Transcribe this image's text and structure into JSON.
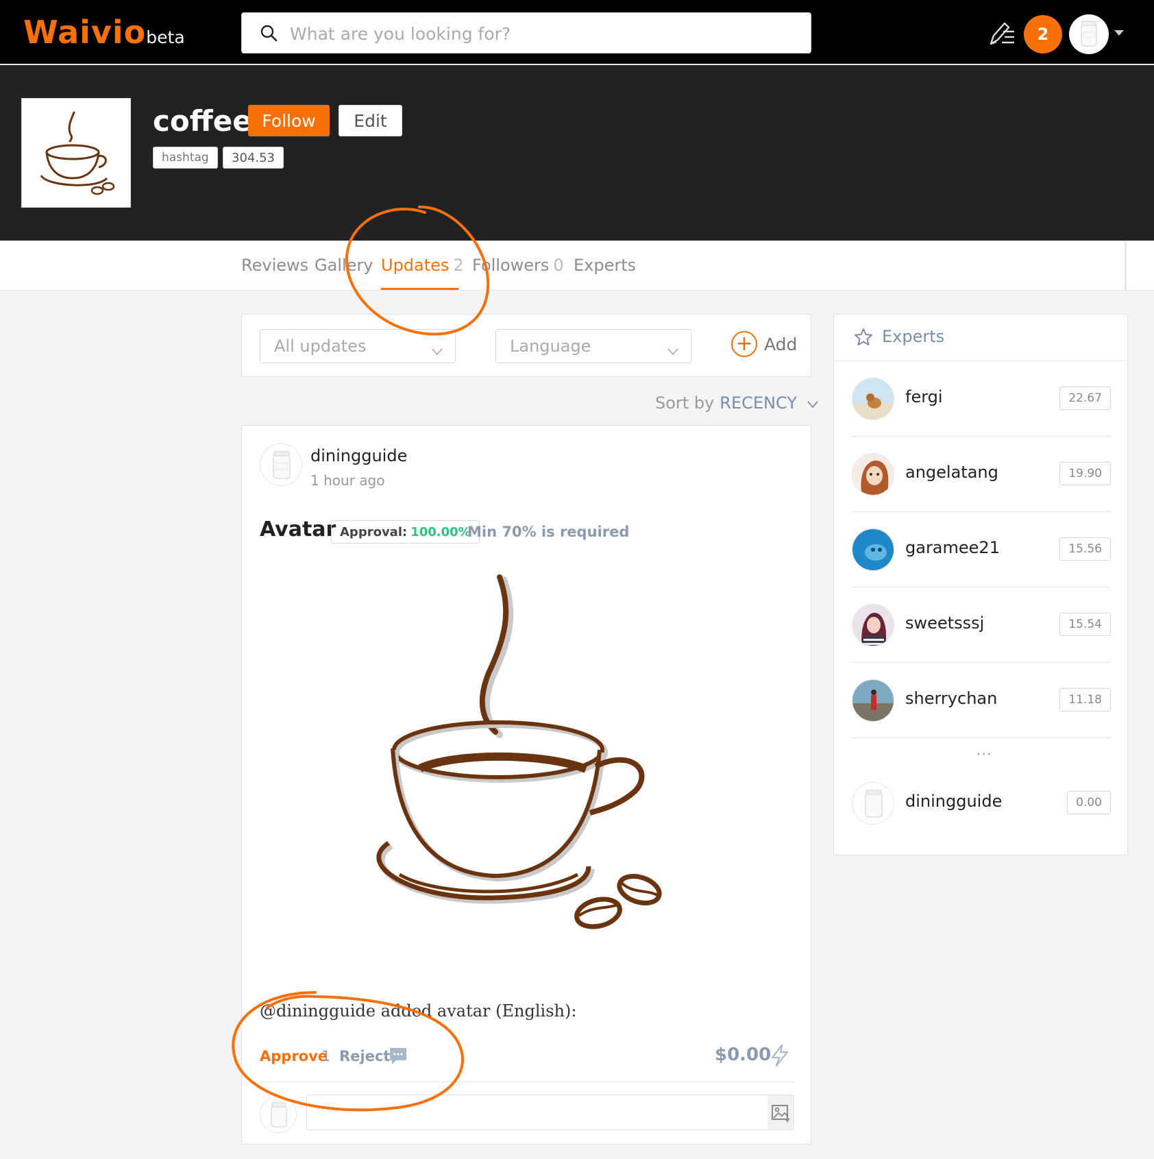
{
  "header": {
    "logo_main": "Waivio",
    "logo_suffix": "beta",
    "search_placeholder": "What are you looking for?",
    "notification_count": "2"
  },
  "object": {
    "name": "coffee",
    "follow_label": "Follow",
    "edit_label": "Edit",
    "type_tag": "hashtag",
    "weight": "304.53"
  },
  "tabs": [
    {
      "label": "Reviews",
      "count": ""
    },
    {
      "label": "Gallery",
      "count": ""
    },
    {
      "label": "Updates",
      "count": "2"
    },
    {
      "label": "Followers",
      "count": "0"
    },
    {
      "label": "Experts",
      "count": ""
    }
  ],
  "filters": {
    "updates_placeholder": "All updates",
    "language_placeholder": "Language",
    "add_label": "Add",
    "sort_label": "Sort by",
    "sort_value": "RECENCY"
  },
  "update": {
    "author": "diningguide",
    "time": "1 hour ago",
    "field": "Avatar",
    "approval_label": "Approval:",
    "approval_value": "100.00%",
    "min_required": "Min 70% is required",
    "text": "@diningguide added avatar (English):",
    "approve_label": "Approve",
    "approve_count": "1",
    "reject_label": "Reject",
    "payout": "$0.00"
  },
  "experts": {
    "title": "Experts",
    "list": [
      {
        "name": "fergi",
        "score": "22.67"
      },
      {
        "name": "angelatang",
        "score": "19.90"
      },
      {
        "name": "garamee21",
        "score": "15.56"
      },
      {
        "name": "sweetsssj",
        "score": "15.54"
      },
      {
        "name": "sherrychan",
        "score": "11.18"
      }
    ],
    "ellipsis": "...",
    "self": {
      "name": "diningguide",
      "score": "0.00"
    }
  },
  "colors": {
    "brand_orange": "#f87007",
    "header_bg": "#000000",
    "hero_bg": "#222222",
    "approval_green": "#2ec27e",
    "muted_blue": "#8a9bb0",
    "coffee_brown": "#6b3410"
  },
  "icons": [
    "search-icon",
    "write-post-icon",
    "chevron-down-icon",
    "plus-circle-icon",
    "star-icon",
    "comment-icon",
    "flash-icon",
    "image-upload-icon",
    "salt-jar-avatar-icon",
    "coffee-cup-icon"
  ]
}
